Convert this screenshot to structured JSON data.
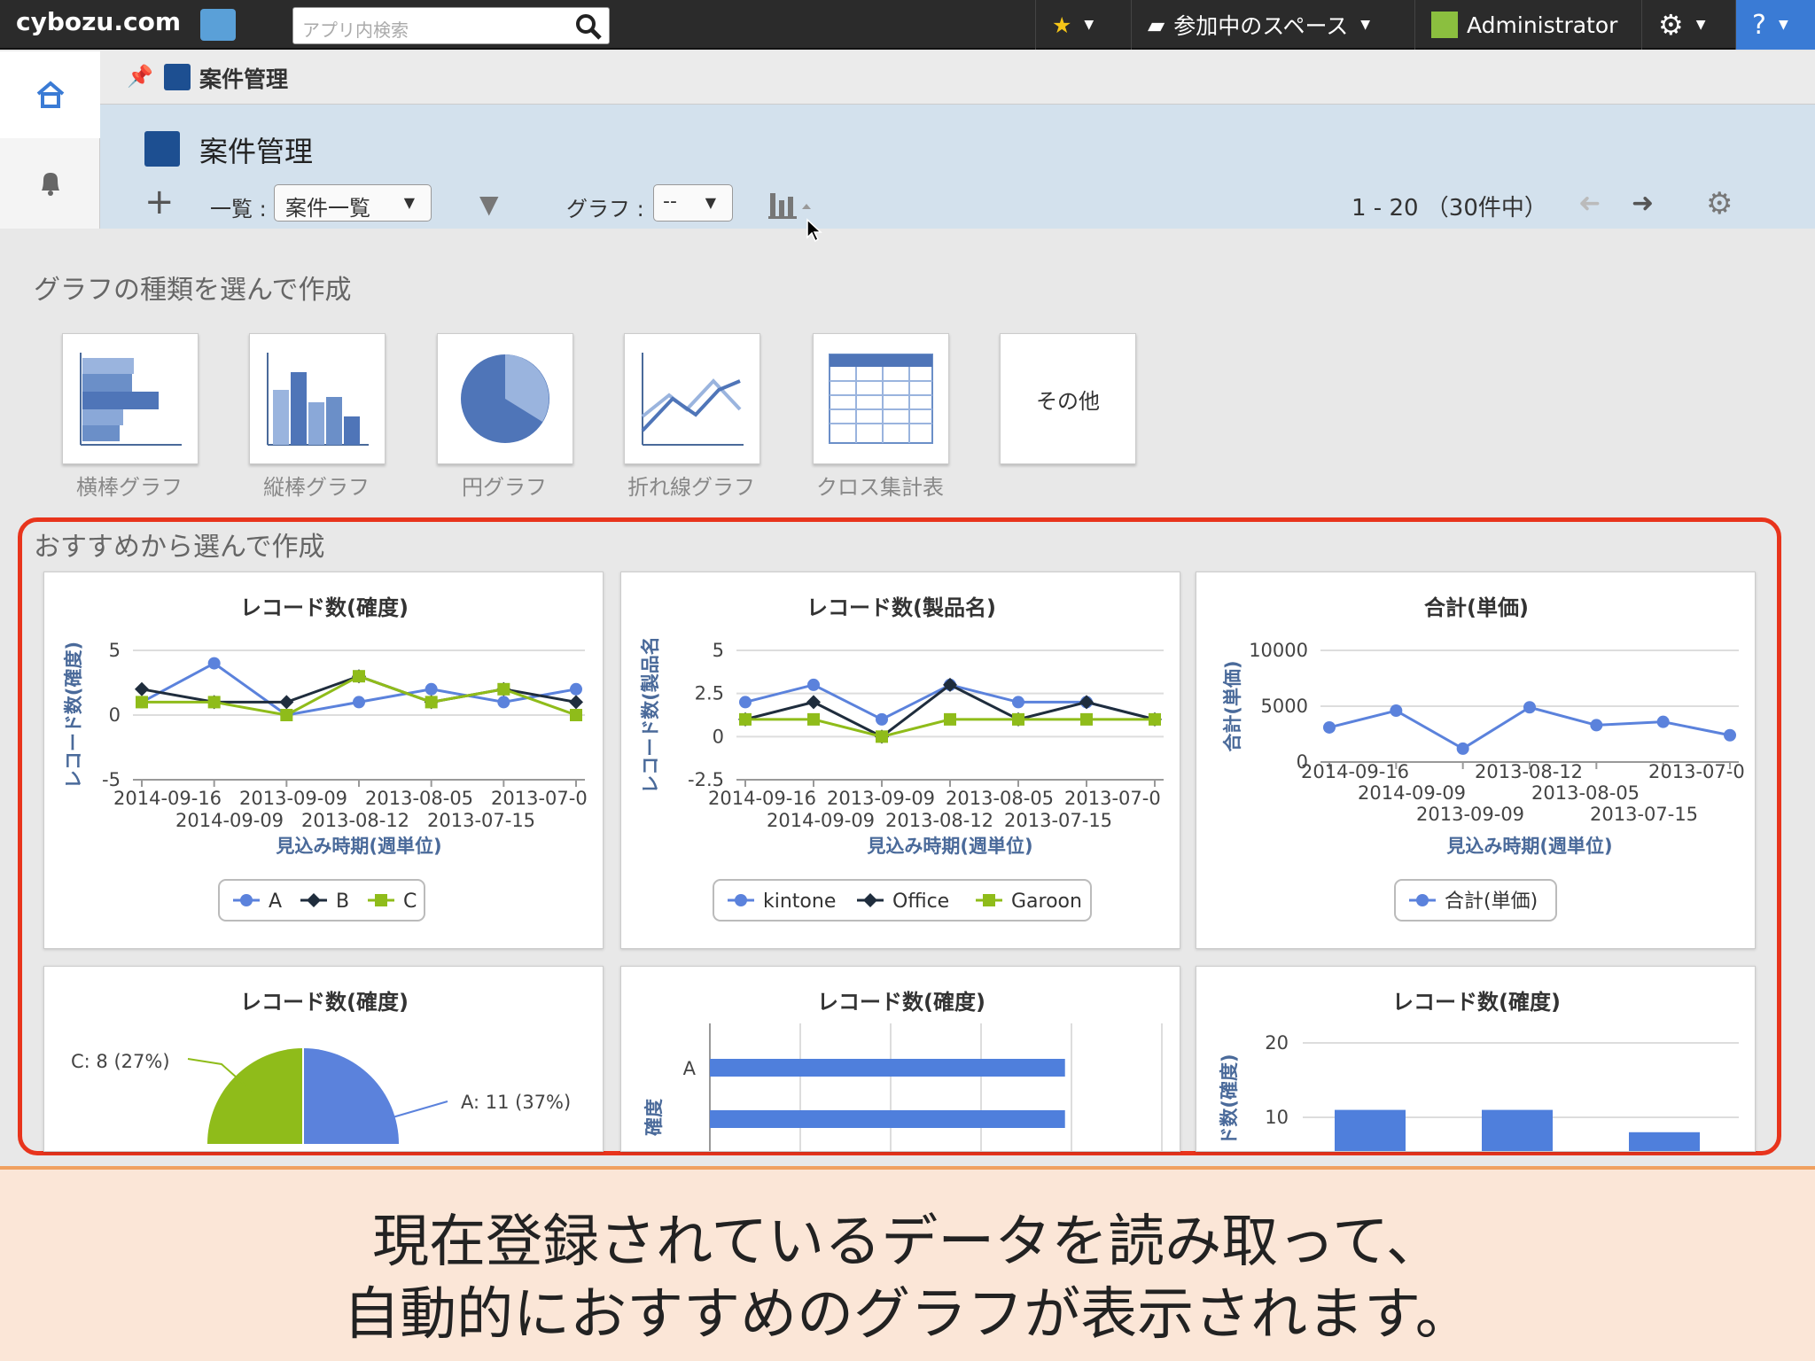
{
  "topbar": {
    "logo": "cybozu.com",
    "search_placeholder": "アプリ内検索",
    "star_label": "★",
    "spaces_label": "参加中のスペース",
    "user_label": "Administrator",
    "help_label": "?"
  },
  "breadcrumb": {
    "app_name": "案件管理"
  },
  "header": {
    "title": "案件管理",
    "view_label": "一覧 :",
    "view_value": "案件一覧",
    "graph_label": "グラフ :",
    "graph_value": "--",
    "paging": "1 - 20 （30件中）"
  },
  "chart_types": {
    "title": "グラフの種類を選んで作成",
    "items": [
      {
        "label": "横棒グラフ",
        "icon": "horizontal-bar-icon"
      },
      {
        "label": "縦棒グラフ",
        "icon": "vertical-bar-icon"
      },
      {
        "label": "円グラフ",
        "icon": "pie-icon"
      },
      {
        "label": "折れ線グラフ",
        "icon": "line-icon"
      },
      {
        "label": "クロス集計表",
        "icon": "table-icon"
      },
      {
        "label": "その他",
        "icon": ""
      }
    ]
  },
  "recommend": {
    "title": "おすすめから選んで作成"
  },
  "chart_data": [
    {
      "type": "line",
      "title": "レコード数(確度)",
      "ylabel": "レコード数(確度)",
      "xlabel": "見込み時期(週単位)",
      "ylim": [
        -5,
        5
      ],
      "yticks": [
        "5",
        "0",
        "-5"
      ],
      "xticks_row1": [
        "2014-09-16",
        "2013-09-09",
        "2013-08-05",
        "2013-07-0"
      ],
      "xticks_row2": [
        "2014-09-09",
        "2013-08-12",
        "2013-07-15"
      ],
      "series": [
        {
          "name": "A",
          "values": [
            1,
            4,
            0,
            1,
            2,
            1,
            2
          ]
        },
        {
          "name": "B",
          "values": [
            2,
            1,
            1,
            3,
            1,
            2,
            1
          ]
        },
        {
          "name": "C",
          "values": [
            1,
            1,
            0,
            3,
            1,
            2,
            0
          ]
        }
      ]
    },
    {
      "type": "line",
      "title": "レコード数(製品名)",
      "ylabel": "レコード数(製品名",
      "xlabel": "見込み時期(週単位)",
      "ylim": [
        -2.5,
        5
      ],
      "yticks": [
        "5",
        "2.5",
        "0",
        "-2.5"
      ],
      "xticks_row1": [
        "2014-09-16",
        "2013-09-09",
        "2013-08-05",
        "2013-07-0"
      ],
      "xticks_row2": [
        "2014-09-09",
        "2013-08-12",
        "2013-07-15"
      ],
      "series": [
        {
          "name": "kintone",
          "values": [
            2,
            3,
            1,
            3,
            2,
            2,
            1
          ]
        },
        {
          "name": "Office",
          "values": [
            1,
            2,
            0,
            3,
            1,
            2,
            1
          ]
        },
        {
          "name": "Garoon",
          "values": [
            1,
            1,
            0,
            1,
            1,
            1,
            1
          ]
        }
      ]
    },
    {
      "type": "line",
      "title": "合計(単価)",
      "ylabel": "合計(単価)",
      "xlabel": "見込み時期(週単位)",
      "ylim": [
        0,
        10000
      ],
      "yticks": [
        "10000",
        "5000",
        "0"
      ],
      "xticks_row1": [
        "2014-09-16",
        "2013-08-12",
        "2013-07-0"
      ],
      "xticks_row2": [
        "2014-09-09",
        "2013-08-05"
      ],
      "xticks_row3": [
        "2013-09-09",
        "2013-07-15"
      ],
      "series": [
        {
          "name": "合計(単価)",
          "values": [
            3100,
            4600,
            1200,
            4900,
            3300,
            3600,
            2400
          ]
        }
      ]
    },
    {
      "type": "pie",
      "title": "レコード数(確度)",
      "slices": [
        {
          "label": "A: 11 (37%)",
          "value": 11
        },
        {
          "label": "C: 8 (27%)",
          "value": 8
        }
      ]
    },
    {
      "type": "bar",
      "title": "レコード数(確度)",
      "ylabel": "確度",
      "categories": [
        "A"
      ],
      "values": [
        11,
        11
      ]
    },
    {
      "type": "bar",
      "title": "レコード数(確度)",
      "ylabel": "ド数(確度)",
      "yticks": [
        "20",
        "10"
      ],
      "ylim": [
        0,
        20
      ],
      "values": [
        11,
        11,
        8
      ]
    }
  ],
  "colors": {
    "a": "#5b82dc",
    "b": "#1f2d3d",
    "c": "#8fbc1a",
    "bar": "#4f7fdc",
    "highlight": "#e8341c"
  },
  "caption": {
    "line1": "現在登録されているデータを読み取って、",
    "line2": "自動的におすすめのグラフが表示されます。"
  }
}
